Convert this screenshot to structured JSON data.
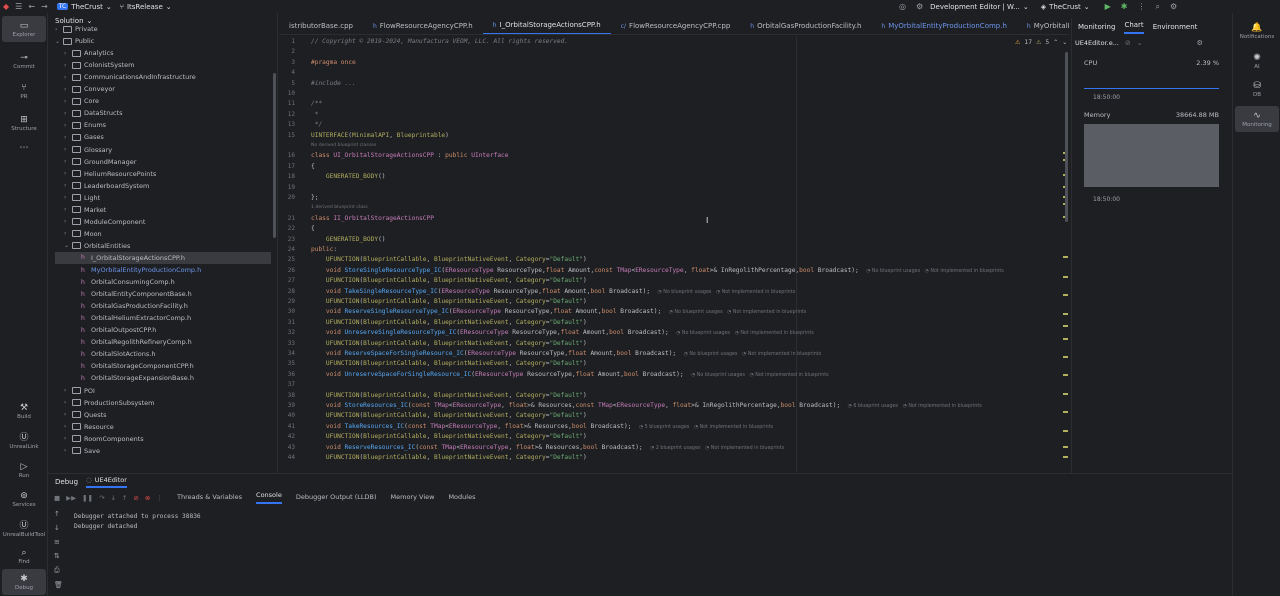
{
  "titlebar": {
    "project_badge": "TC",
    "project_name": "TheCrust",
    "branch": "ItsRelease",
    "run_config": "Development Editor | W...",
    "target": "TheCrust"
  },
  "left_bar": [
    {
      "label": "Explorer",
      "icon": "folder-icon"
    },
    {
      "label": "Commit",
      "icon": "commit-icon"
    },
    {
      "label": "PR",
      "icon": "pull-request-icon"
    },
    {
      "label": "Structure",
      "icon": "structure-icon"
    },
    {
      "label": "...",
      "icon": "more-icon"
    },
    {
      "label": "Build",
      "icon": "hammer-icon"
    },
    {
      "label": "UnrealLink",
      "icon": "unreal-icon"
    },
    {
      "label": "Run",
      "icon": "run-icon"
    },
    {
      "label": "Services",
      "icon": "services-icon"
    },
    {
      "label": "UnrealBuildTool",
      "icon": "unreal-icon"
    },
    {
      "label": "Find",
      "icon": "search-icon"
    },
    {
      "label": "Debug",
      "icon": "bug-icon"
    }
  ],
  "solution": {
    "title": "Solution",
    "items": [
      {
        "label": "Private",
        "type": "folder",
        "level": 0,
        "expanded": false
      },
      {
        "label": "Public",
        "type": "folder",
        "level": 0,
        "expanded": true
      },
      {
        "label": "Analytics",
        "type": "folder",
        "level": 1,
        "expanded": false
      },
      {
        "label": "ColonistSystem",
        "type": "folder",
        "level": 1,
        "expanded": false
      },
      {
        "label": "CommunicationsAndInfrastructure",
        "type": "folder",
        "level": 1,
        "expanded": false
      },
      {
        "label": "Conveyor",
        "type": "folder",
        "level": 1,
        "expanded": false
      },
      {
        "label": "Core",
        "type": "folder",
        "level": 1,
        "expanded": false
      },
      {
        "label": "DataStructs",
        "type": "folder",
        "level": 1,
        "expanded": false
      },
      {
        "label": "Enums",
        "type": "folder",
        "level": 1,
        "expanded": false
      },
      {
        "label": "Gases",
        "type": "folder",
        "level": 1,
        "expanded": false
      },
      {
        "label": "Glossary",
        "type": "folder",
        "level": 1,
        "expanded": false
      },
      {
        "label": "GroundManager",
        "type": "folder",
        "level": 1,
        "expanded": false
      },
      {
        "label": "HeliumResourcePoints",
        "type": "folder",
        "level": 1,
        "expanded": false
      },
      {
        "label": "LeaderboardSystem",
        "type": "folder",
        "level": 1,
        "expanded": false
      },
      {
        "label": "Light",
        "type": "folder",
        "level": 1,
        "expanded": false
      },
      {
        "label": "Market",
        "type": "folder",
        "level": 1,
        "expanded": false
      },
      {
        "label": "ModuleComponent",
        "type": "folder",
        "level": 1,
        "expanded": false
      },
      {
        "label": "Moon",
        "type": "folder",
        "level": 1,
        "expanded": false
      },
      {
        "label": "OrbitalEntities",
        "type": "folder",
        "level": 1,
        "expanded": true
      },
      {
        "label": "I_OrbitalStorageActionsCPP.h",
        "type": "file",
        "level": 2,
        "selected": true
      },
      {
        "label": "MyOrbitalEntityProductionComp.h",
        "type": "file",
        "level": 2,
        "blue": true
      },
      {
        "label": "OrbitalConsumingComp.h",
        "type": "file",
        "level": 2
      },
      {
        "label": "OrbitalEntityComponentBase.h",
        "type": "file",
        "level": 2
      },
      {
        "label": "OrbitalGasProductionFacility.h",
        "type": "file",
        "level": 2
      },
      {
        "label": "OrbitalHeliumExtractorComp.h",
        "type": "file",
        "level": 2
      },
      {
        "label": "OrbitalOutpostCPP.h",
        "type": "file",
        "level": 2
      },
      {
        "label": "OrbitalRegolithRefineryComp.h",
        "type": "file",
        "level": 2
      },
      {
        "label": "OrbitalSlotActions.h",
        "type": "file",
        "level": 2
      },
      {
        "label": "OrbitalStorageComponentCPP.h",
        "type": "file",
        "level": 2
      },
      {
        "label": "OrbitalStorageExpansionBase.h",
        "type": "file",
        "level": 2
      },
      {
        "label": "POI",
        "type": "folder",
        "level": 1,
        "expanded": false
      },
      {
        "label": "ProductionSubsystem",
        "type": "folder",
        "level": 1,
        "expanded": false
      },
      {
        "label": "Quests",
        "type": "folder",
        "level": 1,
        "expanded": false
      },
      {
        "label": "Resource",
        "type": "folder",
        "level": 1,
        "expanded": false
      },
      {
        "label": "RoomComponents",
        "type": "folder",
        "level": 1,
        "expanded": false
      },
      {
        "label": "Save",
        "type": "folder",
        "level": 1,
        "expanded": false
      }
    ]
  },
  "tabs": [
    {
      "label": "istributorBase.cpp",
      "kind": "cpp"
    },
    {
      "label": "FlowResourceAgencyCPP.h",
      "kind": "h"
    },
    {
      "label": "I_OrbitalStorageActionsCPP.h",
      "kind": "h",
      "active": true
    },
    {
      "label": "FlowResourceAgencyCPP.cpp",
      "kind": "cpp"
    },
    {
      "label": "OrbitalGasProductionFacility.h",
      "kind": "h"
    },
    {
      "label": "MyOrbitalEntityProductionComp.h",
      "kind": "h",
      "blue": true
    },
    {
      "label": "MyOrbitalEnti",
      "kind": "h"
    }
  ],
  "editor": {
    "warnings": "17",
    "weak_warnings": "5",
    "lines": [
      {
        "n": "1",
        "html": "<span class='cm'>// Copyright © 2019-2024, Manufactura VEOM, LLC. All rights reserved.</span>"
      },
      {
        "n": "2",
        "html": ""
      },
      {
        "n": "3",
        "html": "<span class='kw'>#pragma once</span>"
      },
      {
        "n": "4",
        "html": ""
      },
      {
        "n": "5",
        "html": "<span class='cm'>#include ...</span>"
      },
      {
        "n": "10",
        "html": ""
      },
      {
        "n": "11",
        "html": "<span class='cm'>/**</span>"
      },
      {
        "n": "12",
        "html": "<span class='cm'> *</span>"
      },
      {
        "n": "13",
        "html": "<span class='cm'> */</span>"
      },
      {
        "n": "15",
        "html": "<span class='mac'>UINTERFACE</span>(<span class='mac'>MinimalAPI</span>, <span class='mac'>Blueprintable</span>)"
      },
      {
        "hint": "No derived blueprint classes"
      },
      {
        "n": "16",
        "html": "<span class='kw'>class</span> <span class='ty'>UI_OrbitalStorageActionsCPP</span> : <span class='kw'>public</span> <span class='ty'>UInterface</span>"
      },
      {
        "n": "17",
        "html": "{"
      },
      {
        "n": "18",
        "html": "    <span class='mac'>GENERATED_BODY</span>()"
      },
      {
        "n": "19",
        "html": ""
      },
      {
        "n": "20",
        "html": "};"
      },
      {
        "hint": "1 derived blueprint class"
      },
      {
        "n": "21",
        "html": "<span class='kw'>class</span> <span class='ty'>II_OrbitalStorageActionsCPP</span>"
      },
      {
        "n": "22",
        "html": "{"
      },
      {
        "n": "23",
        "html": "    <span class='mac'>GENERATED_BODY</span>()"
      },
      {
        "n": "24",
        "html": "<span class='kw'>public</span>:"
      },
      {
        "n": "25",
        "html": "    <span class='mac'>UFUNCTION</span>(<span class='mac'>BlueprintCallable</span>, <span class='mac'>BlueprintNativeEvent</span>, <span class='mac'>Category</span>=<span class='str'>\"Default\"</span>)"
      },
      {
        "n": "26",
        "html": "    <span class='kw'>void</span> <span class='fn'>StoreSingleResourceType_IC</span>(<span class='ty'>EResourceType</span> ResourceType,<span class='kw'>float</span> Amount,<span class='kw'>const</span> <span class='ty'>TMap</span>&lt;<span class='ty'>EResourceType</span>, <span class='kw'>float</span>&gt;&amp; InRegolithPercentage,<span class='kw'>bool</span> Broadcast);  <span class='inl'>◔ No blueprint usages   ◔ Not implemented in blueprints</span>"
      },
      {
        "n": "27",
        "html": "    <span class='mac'>UFUNCTION</span>(<span class='mac'>BlueprintCallable</span>, <span class='mac'>BlueprintNativeEvent</span>, <span class='mac'>Category</span>=<span class='str'>\"Default\"</span>)"
      },
      {
        "n": "28",
        "html": "    <span class='kw'>void</span> <span class='fn'>TakeSingleResourceType_IC</span>(<span class='ty'>EResourceType</span> ResourceType,<span class='kw'>float</span> Amount,<span class='kw'>bool</span> Broadcast);  <span class='inl'>◔ No blueprint usages   ◔ Not implemented in blueprints</span>"
      },
      {
        "n": "29",
        "html": "    <span class='mac'>UFUNCTION</span>(<span class='mac'>BlueprintCallable</span>, <span class='mac'>BlueprintNativeEvent</span>, <span class='mac'>Category</span>=<span class='str'>\"Default\"</span>)"
      },
      {
        "n": "30",
        "html": "    <span class='kw'>void</span> <span class='fn'>ReserveSingleResourceType_IC</span>(<span class='ty'>EResourceType</span> ResourceType,<span class='kw'>float</span> Amount,<span class='kw'>bool</span> Broadcast);  <span class='inl'>◔ No blueprint usages   ◔ Not implemented in blueprints</span>"
      },
      {
        "n": "31",
        "html": "    <span class='mac'>UFUNCTION</span>(<span class='mac'>BlueprintCallable</span>, <span class='mac'>BlueprintNativeEvent</span>, <span class='mac'>Category</span>=<span class='str'>\"Default\"</span>)"
      },
      {
        "n": "32",
        "html": "    <span class='kw'>void</span> <span class='fn'>UnreserveSingleResourceType_IC</span>(<span class='ty'>EResourceType</span> ResourceType,<span class='kw'>float</span> Amount,<span class='kw'>bool</span> Broadcast);  <span class='inl'>◔ No blueprint usages   ◔ Not implemented in blueprints</span>"
      },
      {
        "n": "33",
        "html": "    <span class='mac'>UFUNCTION</span>(<span class='mac'>BlueprintCallable</span>, <span class='mac'>BlueprintNativeEvent</span>, <span class='mac'>Category</span>=<span class='str'>\"Default\"</span>)"
      },
      {
        "n": "34",
        "html": "    <span class='kw'>void</span> <span class='fn'>ReserveSpaceForSingleResource_IC</span>(<span class='ty'>EResourceType</span> ResourceType,<span class='kw'>float</span> Amount,<span class='kw'>bool</span> Broadcast);  <span class='inl'>◔ No blueprint usages   ◔ Not implemented in blueprints</span>"
      },
      {
        "n": "35",
        "html": "    <span class='mac'>UFUNCTION</span>(<span class='mac'>BlueprintCallable</span>, <span class='mac'>BlueprintNativeEvent</span>, <span class='mac'>Category</span>=<span class='str'>\"Default\"</span>)"
      },
      {
        "n": "36",
        "html": "    <span class='kw'>void</span> <span class='fn'>UnreserveSpaceForSingleResource_IC</span>(<span class='ty'>EResourceType</span> ResourceType,<span class='kw'>float</span> Amount,<span class='kw'>bool</span> Broadcast);  <span class='inl'>◔ No blueprint usages   ◔ Not implemented in blueprints</span>"
      },
      {
        "n": "37",
        "html": ""
      },
      {
        "n": "38",
        "html": "    <span class='mac'>UFUNCTION</span>(<span class='mac'>BlueprintCallable</span>, <span class='mac'>BlueprintNativeEvent</span>, <span class='mac'>Category</span>=<span class='str'>\"Default\"</span>)"
      },
      {
        "n": "39",
        "html": "    <span class='kw'>void</span> <span class='fn'>StoreResources_IC</span>(<span class='kw'>const</span> <span class='ty'>TMap</span>&lt;<span class='ty'>EResourceType</span>, <span class='kw'>float</span>&gt;&amp; Resources,<span class='kw'>const</span> <span class='ty'>TMap</span>&lt;<span class='ty'>EResourceType</span>, <span class='kw'>float</span>&gt;&amp; InRegolithPercentage,<span class='kw'>bool</span> Broadcast);  <span class='inl'>◔ 6 blueprint usages   ◔ Not implemented in blueprints</span>"
      },
      {
        "n": "40",
        "html": "    <span class='mac'>UFUNCTION</span>(<span class='mac'>BlueprintCallable</span>, <span class='mac'>BlueprintNativeEvent</span>, <span class='mac'>Category</span>=<span class='str'>\"Default\"</span>)"
      },
      {
        "n": "41",
        "html": "    <span class='kw'>void</span> <span class='fn'>TakeResources_IC</span>(<span class='kw'>const</span> <span class='ty'>TMap</span>&lt;<span class='ty'>EResourceType</span>, <span class='kw'>float</span>&gt;&amp; Resources,<span class='kw'>bool</span> Broadcast);  <span class='inl'>◔ 5 blueprint usages   ◔ Not implemented in blueprints</span>"
      },
      {
        "n": "42",
        "html": "    <span class='mac'>UFUNCTION</span>(<span class='mac'>BlueprintCallable</span>, <span class='mac'>BlueprintNativeEvent</span>, <span class='mac'>Category</span>=<span class='str'>\"Default\"</span>)"
      },
      {
        "n": "43",
        "html": "    <span class='kw'>void</span> <span class='fn'>ReserveResources_IC</span>(<span class='kw'>const</span> <span class='ty'>TMap</span>&lt;<span class='ty'>EResourceType</span>, <span class='kw'>float</span>&gt;&amp; Resources,<span class='kw'>bool</span> Broadcast);  <span class='inl'>◔ 2 blueprint usages   ◔ Not implemented in blueprints</span>"
      },
      {
        "n": "44",
        "html": "    <span class='mac'>UFUNCTION</span>(<span class='mac'>BlueprintCallable</span>, <span class='mac'>BlueprintNativeEvent</span>, <span class='mac'>Category</span>=<span class='str'>\"Default\"</span>)"
      }
    ]
  },
  "monitoring": {
    "title": "Monitoring",
    "tabs": [
      "Chart",
      "Environment"
    ],
    "process": "UE4Editor.e...",
    "cpu_label": "CPU",
    "cpu_value": "2.39 %",
    "cpu_time": "18:50:00",
    "memory_label": "Memory",
    "memory_value": "38664.88 MB",
    "memory_time": "18:50:00"
  },
  "right_bar": [
    {
      "label": "Notifications",
      "icon": "bell-icon"
    },
    {
      "label": "AI",
      "icon": "ai-icon"
    },
    {
      "label": "DB",
      "icon": "database-icon"
    },
    {
      "label": "Monitoring",
      "icon": "monitoring-icon"
    }
  ],
  "debug": {
    "title": "Debug",
    "session": "UE4Editor",
    "tabs": [
      "Threads & Variables",
      "Console",
      "Debugger Output (LLDB)",
      "Memory View",
      "Modules"
    ],
    "active_tab": "Console",
    "console_lines": [
      "Debugger attached to process 38836",
      "Debugger detached"
    ]
  },
  "colors": {
    "accent": "#3574f0",
    "bg": "#1e1f22",
    "selected": "#393b40"
  }
}
